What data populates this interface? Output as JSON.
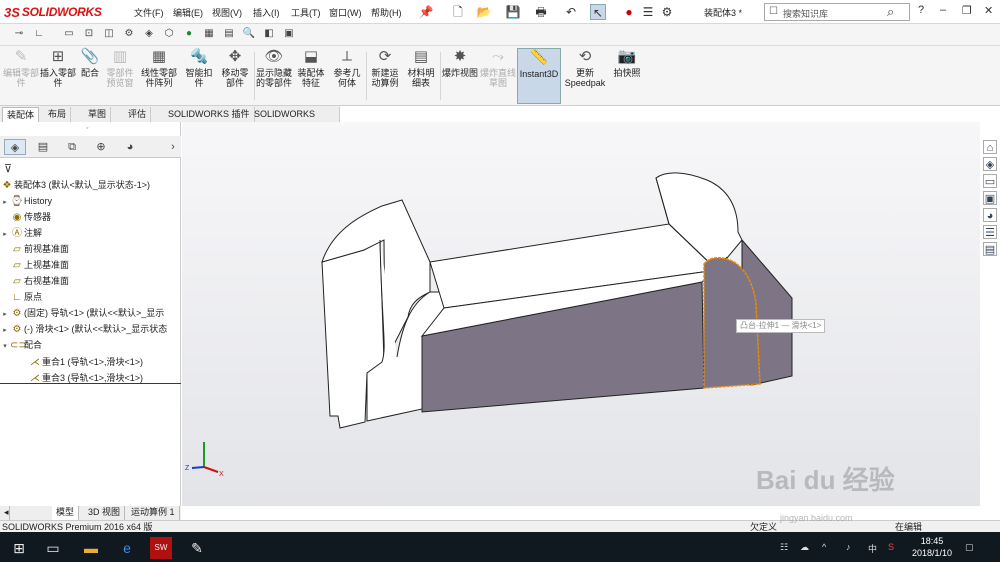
{
  "app": {
    "brand_prefix": "3S",
    "brand": "SOLIDWORKS",
    "document_title": "装配体3 *"
  },
  "menu": [
    "文件(F)",
    "编辑(E)",
    "视图(V)",
    "插入(I)",
    "工具(T)",
    "窗口(W)",
    "帮助(H)"
  ],
  "search": {
    "placeholder": "搜索知识库"
  },
  "ribbon": [
    {
      "label": "编辑零部件",
      "icon": "edit-component-icon",
      "disabled": true
    },
    {
      "label": "插入零部件",
      "icon": "insert-component-icon",
      "disabled": false
    },
    {
      "label": "配合",
      "icon": "mate-icon",
      "disabled": false
    },
    {
      "label": "零部件预览窗",
      "icon": "component-preview-icon",
      "disabled": true
    },
    {
      "label": "线性零部件阵列",
      "icon": "linear-pattern-icon",
      "disabled": false
    },
    {
      "label": "智能扣件",
      "icon": "smart-fasteners-icon",
      "disabled": false
    },
    {
      "label": "移动零部件",
      "icon": "move-component-icon",
      "disabled": false
    },
    {
      "label": "显示隐藏的零部件",
      "icon": "show-hidden-icon",
      "disabled": false
    },
    {
      "label": "装配体特征",
      "icon": "assembly-features-icon",
      "disabled": false
    },
    {
      "label": "参考几何体",
      "icon": "reference-geometry-icon",
      "disabled": false
    },
    {
      "label": "新建运动算例",
      "icon": "new-motion-study-icon",
      "disabled": false
    },
    {
      "label": "材料明细表",
      "icon": "bill-of-materials-icon",
      "disabled": false
    },
    {
      "label": "爆炸视图",
      "icon": "exploded-view-icon",
      "disabled": false
    },
    {
      "label": "爆炸直线草图",
      "icon": "explode-line-sketch-icon",
      "disabled": true
    },
    {
      "label": "Instant3D",
      "icon": "instant3d-icon",
      "disabled": false,
      "active": true
    },
    {
      "label": "更新Speedpak",
      "icon": "speedpak-icon",
      "disabled": false
    },
    {
      "label": "拍快照",
      "icon": "snapshot-icon",
      "disabled": false
    }
  ],
  "tabs": [
    "装配体",
    "布局",
    "草图",
    "评估",
    "SOLIDWORKS 插件",
    "SOLIDWORKS MBD"
  ],
  "tree": {
    "root": "装配体3  (默认<默认_显示状态-1>)",
    "items": [
      {
        "label": "History",
        "arrow": "▸"
      },
      {
        "label": "传感器",
        "arrow": ""
      },
      {
        "label": "注解",
        "arrow": "▸"
      },
      {
        "label": "前视基准面",
        "arrow": ""
      },
      {
        "label": "上视基准面",
        "arrow": ""
      },
      {
        "label": "右视基准面",
        "arrow": ""
      },
      {
        "label": "原点",
        "arrow": ""
      },
      {
        "label": "(固定) 导轨<1> (默认<<默认>_显示",
        "arrow": "▸"
      },
      {
        "label": "(-) 滑块<1> (默认<<默认>_显示状态",
        "arrow": "▸"
      },
      {
        "label": "配合",
        "arrow": "▾"
      },
      {
        "label": "重合1 (导轨<1>,滑块<1>)",
        "arrow": ""
      },
      {
        "label": "重合3 (导轨<1>,滑块<1>)",
        "arrow": ""
      }
    ]
  },
  "bottom_tabs": [
    "模型",
    "3D 视图",
    "运动算例 1"
  ],
  "status": {
    "left": "SOLIDWORKS Premium 2016 x64 版",
    "middle": "欠定义",
    "right": "在编辑"
  },
  "tooltip": "凸台-拉伸1 — 滑块<1>",
  "taskbar": {
    "clock_time": "18:45",
    "clock_date": "2018/1/10",
    "ime": "中"
  },
  "watermark": {
    "main": "Bai du 经验",
    "sub": "jingyan.baidu.com"
  },
  "colors": {
    "brand_red": "#d11111",
    "active_tab": "#c8d8e8",
    "part_face": "#7d7585",
    "edge": "#222222",
    "selection": "#f08a00"
  }
}
